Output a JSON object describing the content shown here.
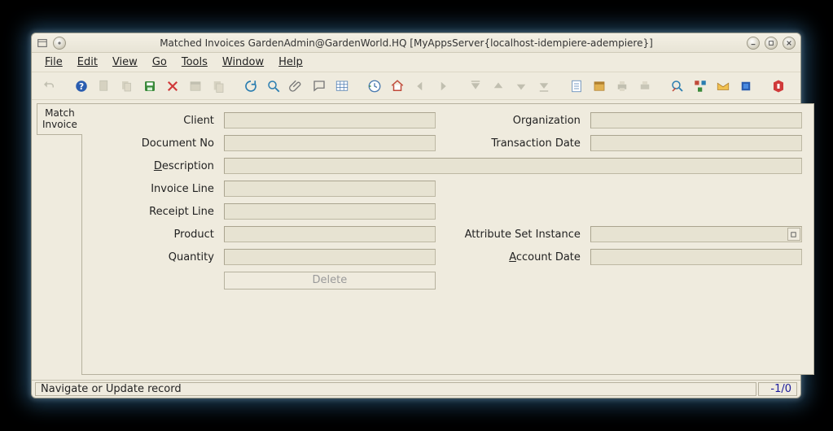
{
  "window": {
    "title": "Matched Invoices  GardenAdmin@GardenWorld.HQ [MyAppsServer{localhost-idempiere-adempiere}]"
  },
  "menu": {
    "file": "File",
    "edit": "Edit",
    "view": "View",
    "go": "Go",
    "tools": "Tools",
    "window": "Window",
    "help": "Help"
  },
  "tab": {
    "label": "Match Invoice"
  },
  "form": {
    "client_label": "Client",
    "organization_label": "Organization",
    "documentno_label": "Document No",
    "transactiondate_label": "Transaction Date",
    "description_label": "Description",
    "invoiceline_label": "Invoice Line",
    "receiptline_label": "Receipt Line",
    "product_label": "Product",
    "attrsetinstance_label": "Attribute Set Instance",
    "quantity_label": "Quantity",
    "accountdate_label": "Account Date",
    "delete_label": "Delete",
    "client_value": "",
    "organization_value": "",
    "documentno_value": "",
    "transactiondate_value": "",
    "description_value": "",
    "invoiceline_value": "",
    "receiptline_value": "",
    "product_value": "",
    "attrsetinstance_value": "",
    "quantity_value": "",
    "accountdate_value": ""
  },
  "status": {
    "message": "Navigate or Update record",
    "counter": "-1/0"
  }
}
